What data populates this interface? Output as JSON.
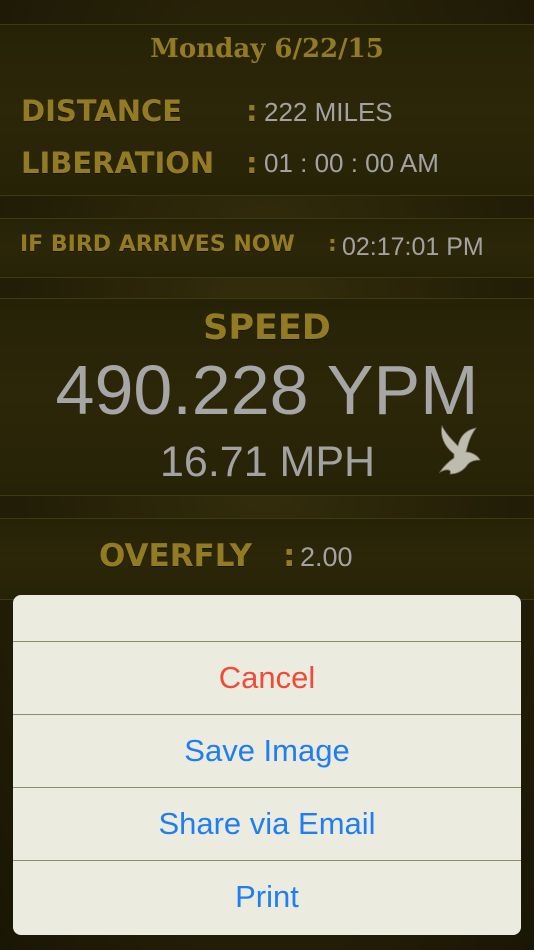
{
  "header": {
    "date": "Monday  6/22/15"
  },
  "distance": {
    "label": "DISTANCE",
    "value": "222 MILES"
  },
  "liberation": {
    "label": "LIBERATION",
    "value": "01 : 00 : 00 AM"
  },
  "arrival": {
    "label": "IF BIRD ARRIVES NOW",
    "value": "02:17:01 PM"
  },
  "speed": {
    "label": "SPEED",
    "ypm": "490.228 YPM",
    "mph": "16.71 MPH"
  },
  "overfly": {
    "label": "OVERFLY",
    "value": "2.00"
  },
  "separator": ":",
  "action_sheet": {
    "cancel": "Cancel",
    "save": "Save Image",
    "email": "Share via Email",
    "print": "Print"
  },
  "colors": {
    "gold": "#a88d2a",
    "cancel": "#f04a38",
    "action": "#1f7ef0"
  },
  "icons": {
    "bird": "dove-icon"
  }
}
